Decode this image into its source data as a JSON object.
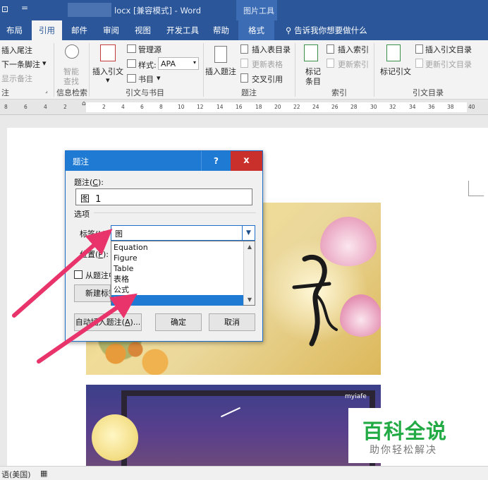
{
  "titlebar": {
    "quick_access_icon": "save-icon",
    "quick_access_dropdown": "=",
    "doc_suffix": "locx [兼容模式] - Word",
    "context_tools": "图片工具"
  },
  "tabs": {
    "items": [
      "布局",
      "引用",
      "邮件",
      "审阅",
      "视图",
      "开发工具",
      "帮助",
      "格式"
    ],
    "active": "引用",
    "search": "告诉我你想要做什么"
  },
  "ribbon": {
    "footnotes": {
      "insert_endnote": "插入尾注",
      "next_footnote": "下一条脚注",
      "show_notes": "显示备注",
      "group": "注"
    },
    "smart": {
      "line1": "智能",
      "line2": "查找",
      "group": "信息检索"
    },
    "citations": {
      "insert_citation": "插入引文",
      "manage_sources": "管理源",
      "style_label": "样式:",
      "style_value": "APA",
      "bibliography": "书目",
      "group": "引文与书目"
    },
    "captions": {
      "insert_caption": "插入题注",
      "insert_table_of_figures": "插入表目录",
      "update_table": "更新表格",
      "cross_reference": "交叉引用",
      "group": "题注"
    },
    "index": {
      "mark_entry_1": "标记",
      "mark_entry_2": "条目",
      "insert_index": "插入索引",
      "update_index": "更新索引",
      "group": "索引"
    },
    "toa": {
      "mark_citation": "标记引文",
      "insert_toa": "插入引文目录",
      "update_toa": "更新引文目录",
      "group": "引文目录"
    }
  },
  "ruler": [
    "8",
    "6",
    "4",
    "2",
    "2",
    "4",
    "6",
    "8",
    "10",
    "12",
    "14",
    "16",
    "18",
    "20",
    "22",
    "24",
    "26",
    "28",
    "30",
    "32",
    "34",
    "36",
    "38",
    "40"
  ],
  "dialog": {
    "title": "题注",
    "help": "?",
    "close": "x",
    "caption_label": "题注(",
    "caption_key": "C",
    "caption_end": "):",
    "caption_value": "图 1",
    "options": "选项",
    "label_label": "标签(",
    "label_key": "L",
    "label_end": "):",
    "label_value": "图",
    "position_label": "位置(",
    "position_key": "P",
    "position_end": "):",
    "exclude_label": "从题注中",
    "new_label_button": "新建标签",
    "label_options": [
      "Equation",
      "Figure",
      "Table",
      "表格",
      "公式",
      "图"
    ],
    "selected_option": "图",
    "autocaption_button": "自动插入题注(",
    "autocaption_key": "A",
    "autocaption_end": ")...",
    "ok_button": "确定",
    "cancel_button": "取消"
  },
  "image2_brand": "myiafe",
  "watermark": {
    "title": "百科全说",
    "subtitle": "助你轻松解决"
  },
  "statusbar": {
    "language": "语(美国)"
  },
  "colors": {
    "word_blue": "#2b579a",
    "dialog_blue": "#1e7ad3",
    "close_red": "#c9302c",
    "arrow_pink": "#e8336b",
    "watermark_green": "#22aa44"
  }
}
